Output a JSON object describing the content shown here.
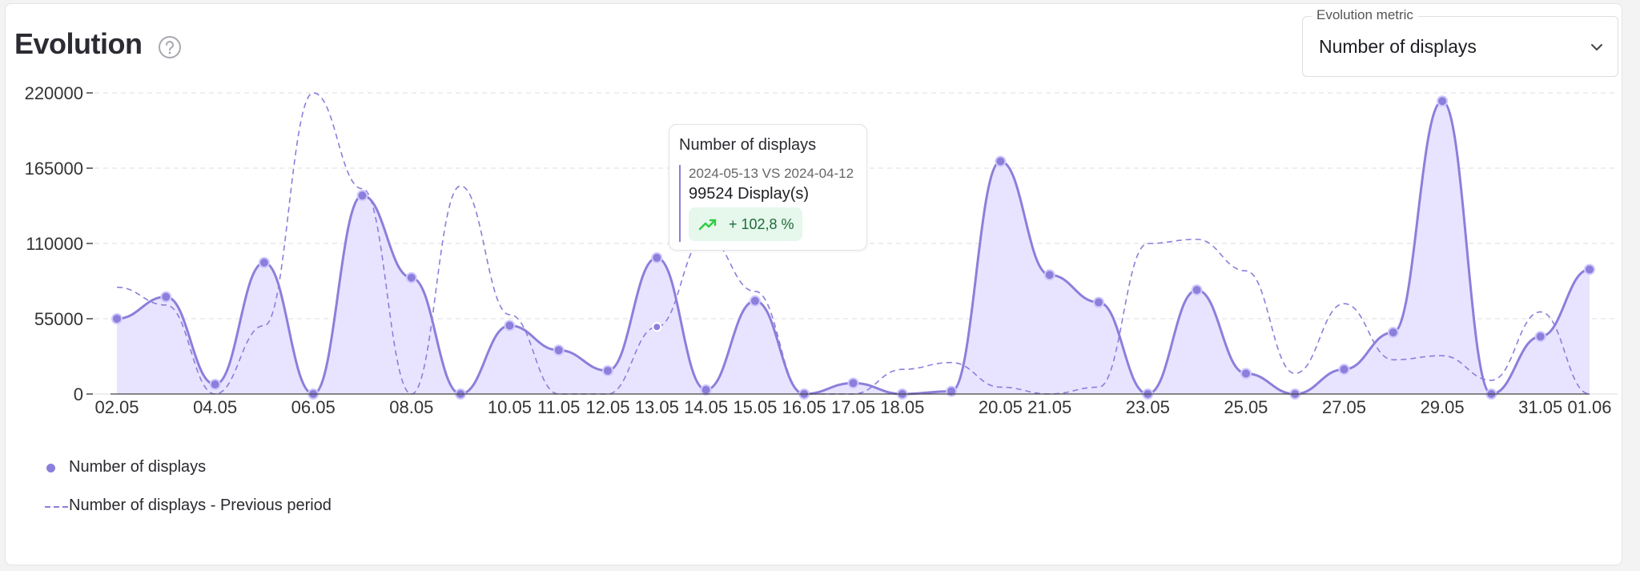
{
  "header": {
    "title": "Evolution",
    "help_icon": "help-circle-icon"
  },
  "metric_select": {
    "legend": "Evolution metric",
    "value": "Number of displays",
    "icon": "chevron-down-icon"
  },
  "tooltip": {
    "title": "Number of displays",
    "dates": "2024-05-13 VS 2024-04-12",
    "value": "99524 Display(s)",
    "change": "+ 102,8 %",
    "icon": "trend-up-icon"
  },
  "legend": {
    "current": "Number of displays",
    "previous": "Number of displays - Previous period"
  },
  "colors": {
    "current_line": "#8b7fdb",
    "current_fill": "#e8e4ff",
    "previous_line": "#8b7fdb",
    "badge_bg": "#e6f7ec",
    "trend_up": "#2ecc40"
  },
  "chart_data": {
    "type": "area",
    "ylim": [
      0,
      220000
    ],
    "yticks": [
      "0",
      "55000",
      "110000",
      "165000",
      "220000"
    ],
    "grid": true,
    "legend_position": "bottom-left",
    "x": [
      "02.05",
      "03.05",
      "04.05",
      "05.05",
      "06.05",
      "07.05",
      "08.05",
      "09.05",
      "10.05",
      "11.05",
      "12.05",
      "13.05",
      "14.05",
      "15.05",
      "16.05",
      "17.05",
      "18.05",
      "19.05",
      "20.05",
      "21.05",
      "22.05",
      "23.05",
      "24.05",
      "25.05",
      "26.05",
      "27.05",
      "28.05",
      "29.05",
      "30.05",
      "31.05",
      "01.06"
    ],
    "xtick_labels": [
      "02.05",
      "",
      "04.05",
      "",
      "06.05",
      "",
      "08.05",
      "",
      "10.05",
      "11.05",
      "12.05",
      "13.05",
      "14.05",
      "15.05",
      "16.05",
      "17.05",
      "18.05",
      "",
      "20.05",
      "21.05",
      "",
      "23.05",
      "",
      "25.05",
      "",
      "27.05",
      "",
      "29.05",
      "",
      "31.05",
      "01.06"
    ],
    "series": [
      {
        "name": "Number of displays",
        "style": "solid-area",
        "values": [
          55000,
          71000,
          7000,
          96000,
          0,
          145000,
          85000,
          0,
          50000,
          32000,
          17000,
          99524,
          3000,
          68000,
          0,
          8000,
          0,
          2000,
          170000,
          87000,
          67000,
          0,
          76000,
          15000,
          0,
          18000,
          45000,
          214000,
          0,
          42000,
          91000
        ]
      },
      {
        "name": "Number of displays - Previous period",
        "style": "dashed",
        "values": [
          78000,
          65000,
          0,
          50000,
          220000,
          150000,
          0,
          152000,
          58000,
          0,
          0,
          49000,
          115000,
          75000,
          0,
          0,
          18000,
          23000,
          5000,
          0,
          5000,
          110000,
          113000,
          90000,
          15000,
          66000,
          25000,
          28000,
          10000,
          60000,
          0
        ]
      }
    ]
  }
}
